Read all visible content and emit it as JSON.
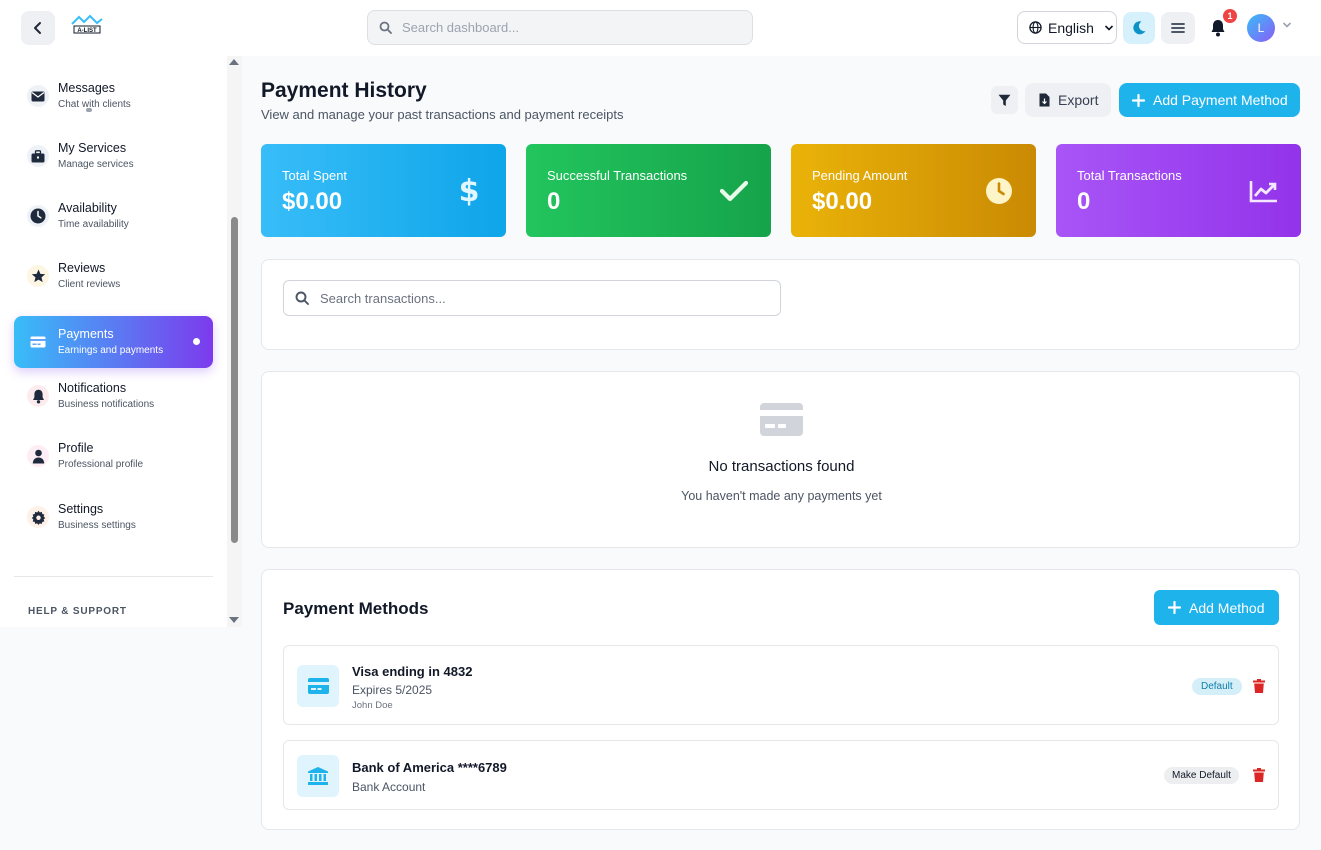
{
  "topbar": {
    "logo_text": "A-LIST",
    "search_placeholder": "Search dashboard...",
    "language": "English",
    "notification_count": "1",
    "avatar_initial": "L"
  },
  "sidebar": {
    "items": [
      {
        "label": "Messages",
        "sub": "Chat with clients",
        "icon": "envelope-icon",
        "color": "#1f2a3d"
      },
      {
        "label": "My Services",
        "sub": "Manage services",
        "icon": "briefcase-icon",
        "color": "#1f2a3d"
      },
      {
        "label": "Availability",
        "sub": "Time availability",
        "icon": "clock-icon",
        "color": "#1f2a3d"
      },
      {
        "label": "Reviews",
        "sub": "Client reviews",
        "icon": "star-icon",
        "color": "#1f2a3d"
      },
      {
        "label": "Payments",
        "sub": "Earnings and payments",
        "icon": "credit-card-icon",
        "active": true
      },
      {
        "label": "Notifications",
        "sub": "Business notifications",
        "icon": "bell-icon",
        "color": "#1f2a3d"
      },
      {
        "label": "Profile",
        "sub": "Professional profile",
        "icon": "user-icon",
        "color": "#1f2a3d"
      },
      {
        "label": "Settings",
        "sub": "Business settings",
        "icon": "gear-icon",
        "color": "#1f2a3d"
      }
    ],
    "help_title": "HELP & SUPPORT"
  },
  "header": {
    "title": "Payment History",
    "subtitle": "View and manage your past transactions and payment receipts",
    "export_label": "Export",
    "add_payment_label": "Add Payment Method"
  },
  "stats": [
    {
      "label": "Total Spent",
      "value": "$0.00",
      "icon": "dollar-icon",
      "gradient": [
        "#38bdf8",
        "#0ea5e9"
      ]
    },
    {
      "label": "Successful Transactions",
      "value": "0",
      "icon": "check-icon",
      "gradient": [
        "#22c55e",
        "#16a34a"
      ]
    },
    {
      "label": "Pending Amount",
      "value": "$0.00",
      "icon": "clock-icon",
      "gradient": [
        "#eab308",
        "#ca8a04"
      ]
    },
    {
      "label": "Total Transactions",
      "value": "0",
      "icon": "chart-line-icon",
      "gradient": [
        "#a855f7",
        "#9333ea"
      ]
    }
  ],
  "transactions": {
    "search_placeholder": "Search transactions...",
    "empty_title": "No transactions found",
    "empty_subtitle": "You haven't made any payments yet"
  },
  "payment_methods": {
    "title": "Payment Methods",
    "add_label": "Add Method",
    "items": [
      {
        "name": "Visa ending in 4832",
        "detail": "Expires 5/2025",
        "holder": "John Doe",
        "badge": "Default",
        "icon": "credit-card-icon"
      },
      {
        "name": "Bank of America ****6789",
        "detail": "Bank Account",
        "badge": "Make Default",
        "icon": "bank-icon"
      }
    ]
  },
  "colors": {
    "accent": "#1fb3ec",
    "danger": "#dc2626"
  }
}
